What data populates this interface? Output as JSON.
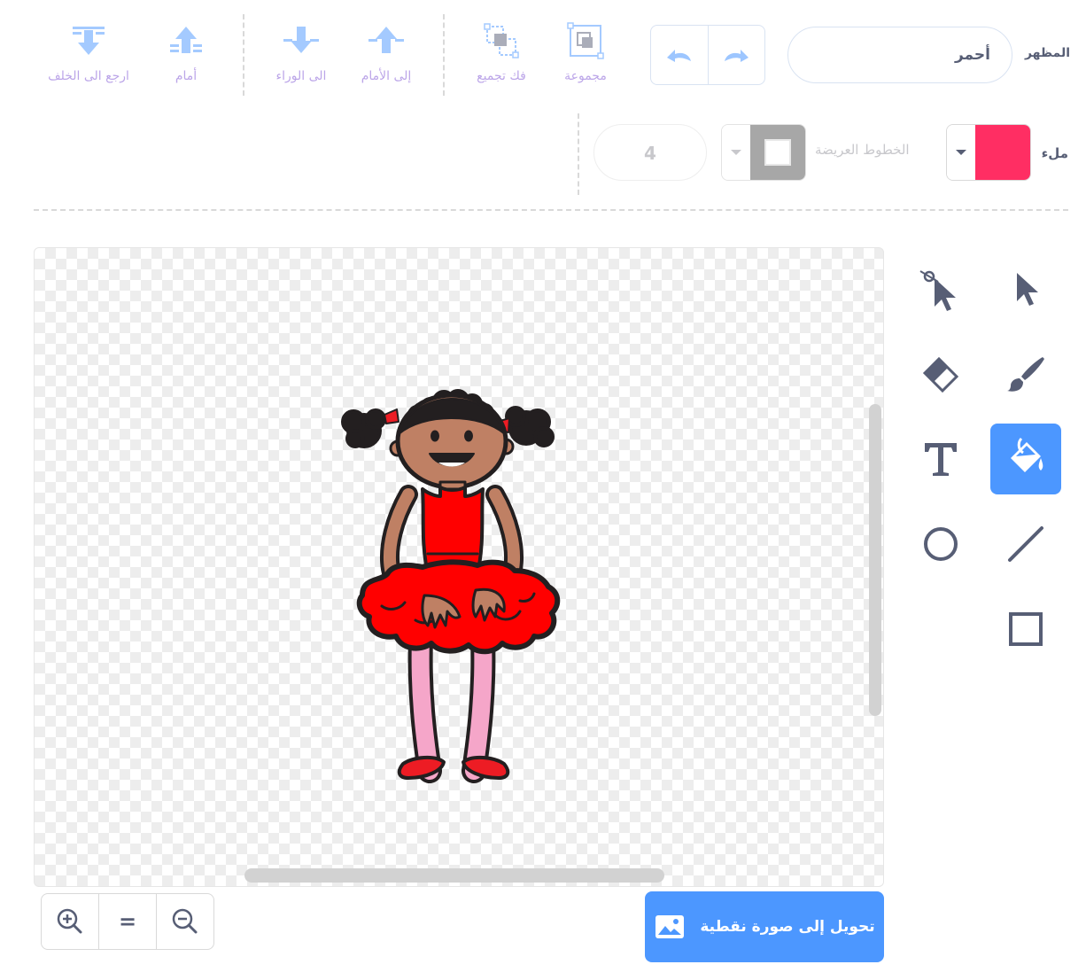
{
  "toolbar": {
    "back_label": "ارجع الى الخلف",
    "front_label": "أمام",
    "backward_label": "الى الوراء",
    "forward_label": "إلى الأمام",
    "ungroup_label": "فك تجميع",
    "group_label": "مجموعة"
  },
  "costume": {
    "label": "المظهر",
    "name": "أحمر"
  },
  "fill": {
    "label": "ملء",
    "color": "#ff2e63"
  },
  "outline": {
    "label": "الخطوط العريضة",
    "color": "#a7a7a7",
    "width": "4"
  },
  "tools": {
    "active": "fill",
    "accent": "#4c97ff",
    "items": [
      "reshape",
      "select",
      "eraser",
      "brush",
      "text",
      "fill",
      "circle",
      "line",
      "rectangle"
    ]
  },
  "bottom": {
    "convert_label": "تحويل إلى صورة نقطية",
    "zoom_in": "zoom-in-icon",
    "zoom_reset": "=",
    "zoom_out": "zoom-out-icon"
  }
}
